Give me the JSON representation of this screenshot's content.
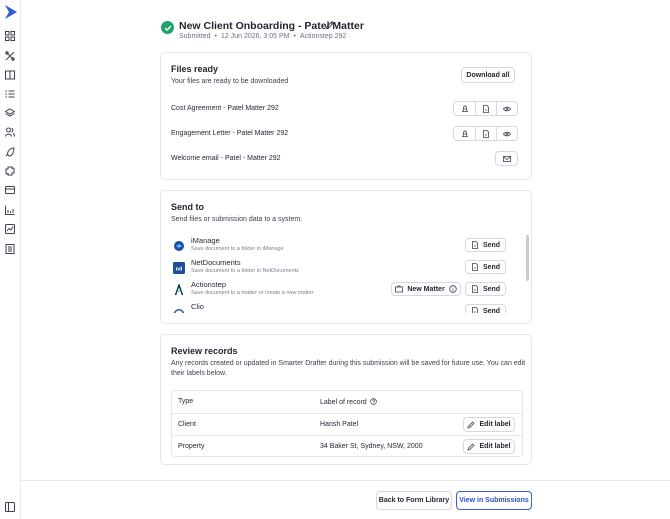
{
  "header": {
    "title": "New Client Onboarding - Patel Matter",
    "status": "Submitted",
    "date": "12 Jun 2026, 3:05 PM",
    "reference": "Actionstep 292"
  },
  "files": {
    "title": "Files ready",
    "description": "Your files are ready to be downloaded",
    "download_all_label": "Download all",
    "items": [
      {
        "name": "Cost Agreement - Patel Matter 292"
      },
      {
        "name": "Engagement Letter - Patel Matter 292"
      },
      {
        "name": "Welcome email - Patel - Matter 292"
      }
    ]
  },
  "send": {
    "title": "Send to",
    "description": "Send files or submission data to a system.",
    "send_label": "Send",
    "new_matter_label": "New Matter",
    "systems": [
      {
        "name": "iManage",
        "description": "Save document to a folder in iManage"
      },
      {
        "name": "NetDocuments",
        "description": "Save document to a folder in NetDocuments"
      },
      {
        "name": "Actionstep",
        "description": "Save document to a matter or create a new matter"
      },
      {
        "name": "Clio",
        "description": ""
      }
    ]
  },
  "review": {
    "title": "Review records",
    "description_line1": "Any records created or updated in Smarter Drafter during this submission will be saved for future use. You can edit",
    "description_line2": "their labels below.",
    "col_type": "Type",
    "col_label": "Label of record",
    "edit_label": "Edit label",
    "rows": [
      {
        "type": "Client",
        "label": "Harish Patel"
      },
      {
        "type": "Property",
        "label": "34 Baker St, Sydney, NSW, 2000"
      }
    ]
  },
  "footer": {
    "back_label": "Back to Form Library",
    "view_label": "View in Submissions"
  },
  "icons": {
    "logo": "brand-chevron-logo",
    "sidebar": [
      "grid-icon",
      "tools-icon",
      "book-icon",
      "list-icon",
      "layers-icon",
      "users-icon",
      "rocket-icon",
      "puzzle-icon",
      "card-icon",
      "bar-chart-icon",
      "line-chart-icon",
      "ledger-icon",
      "panel-toggle-icon"
    ]
  },
  "colors": {
    "brand": "#2f5bd3",
    "success": "#22a06b",
    "primary_border": "#3b5fd9"
  }
}
